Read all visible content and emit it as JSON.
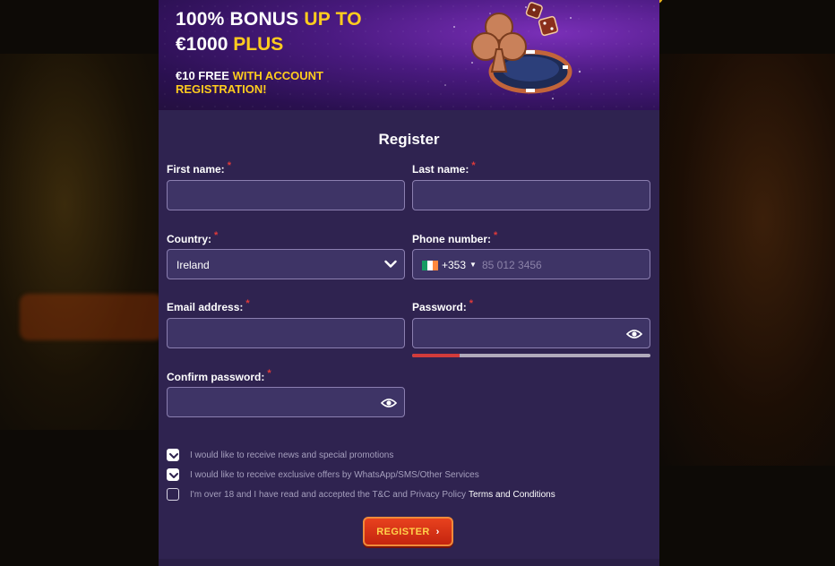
{
  "colors": {
    "modal_bg": "#2f2350",
    "field_bg": "#3e3466",
    "field_border": "#8b7fb0",
    "accent_yellow": "#ffcc1e",
    "required_red": "#e03a3a",
    "register_button": "#d8321a"
  },
  "banner": {
    "headline_a": "100% BONUS ",
    "headline_a_highlight": "UP TO",
    "headline_b": "€1000 ",
    "headline_b_highlight": "PLUS",
    "subline": "€10 FREE ",
    "subline_highlight": "WITH ACCOUNT",
    "subline_rest": "REGISTRATION!",
    "art_icons": [
      "club-chip-icon",
      "dice-icon"
    ]
  },
  "form": {
    "title": "Register",
    "required_mark": "*",
    "first_name": {
      "label": "First name:",
      "value": ""
    },
    "last_name": {
      "label": "Last name:",
      "value": ""
    },
    "country": {
      "label": "Country:",
      "value": "Ireland"
    },
    "phone": {
      "label": "Phone number:",
      "dial_code": "+353",
      "placeholder": "85 012 3456"
    },
    "email": {
      "label": "Email address:",
      "value": ""
    },
    "password": {
      "label": "Password:",
      "value": "",
      "strength": 0.2
    },
    "confirm_password": {
      "label": "Confirm password:",
      "value": ""
    }
  },
  "consents": [
    {
      "text": "I would like to receive news and special promotions",
      "checked": true
    },
    {
      "text": "I would like to receive exclusive offers by WhatsApp/SMS/Other Services",
      "checked": true
    },
    {
      "text": "I'm over 18 and I have read and accepted the T&C and Privacy Policy",
      "link": "Terms and Conditions",
      "checked": false
    }
  ],
  "register_button": {
    "label": "REGISTER",
    "icon": "chevron-right-icon"
  }
}
